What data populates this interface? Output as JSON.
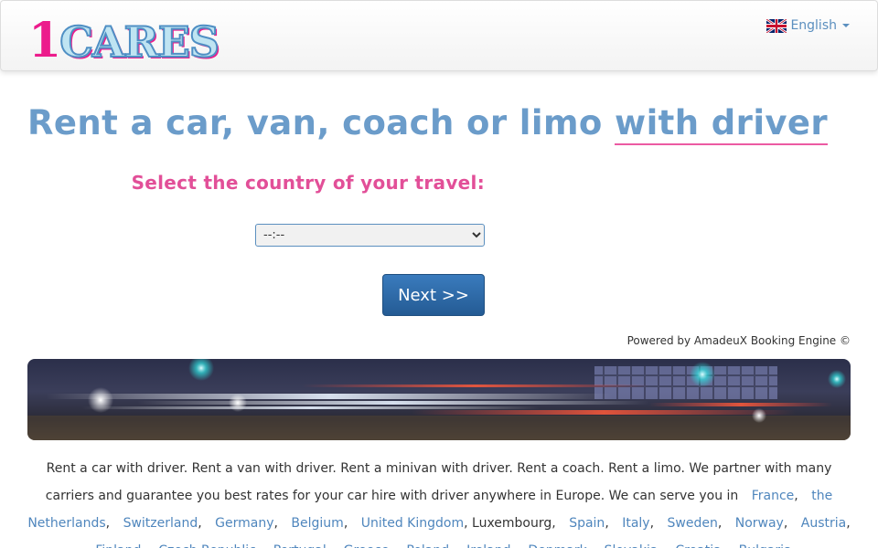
{
  "header": {
    "logo": {
      "number": "1",
      "word": "CARES"
    },
    "language": {
      "label": "English",
      "flag_icon": "uk-flag-icon"
    }
  },
  "main": {
    "headline": {
      "prefix": "Rent a car, van, coach or limo",
      "emphasis": "with driver"
    },
    "select_label": "Select the country of your travel:",
    "country_select": {
      "selected": "--:--"
    },
    "next_button": "Next >>",
    "powered_by": "Powered by AmadeuX Booking Engine ©"
  },
  "description": {
    "intro": "Rent a car with driver. Rent a van with driver. Rent a minivan with driver. Rent a coach. Rent a limo. We partner with many carriers and guarantee you best rates for your car hire with driver anywhere in Europe. We can serve you in",
    "countries": [
      {
        "name": "France",
        "link": true
      },
      {
        "name": "the Netherlands",
        "link": true
      },
      {
        "name": "Switzerland",
        "link": true
      },
      {
        "name": "Germany",
        "link": true
      },
      {
        "name": "Belgium",
        "link": true
      },
      {
        "name": "United Kingdom",
        "link": true
      },
      {
        "name": "Luxembourg",
        "link": false
      },
      {
        "name": "Spain",
        "link": true
      },
      {
        "name": "Italy",
        "link": true
      },
      {
        "name": "Sweden",
        "link": true
      },
      {
        "name": "Norway",
        "link": true
      },
      {
        "name": "Austria",
        "link": true
      },
      {
        "name": "Finland",
        "link": true
      },
      {
        "name": "Czech Republic",
        "link": true
      },
      {
        "name": "Portugal",
        "link": true
      },
      {
        "name": "Greece",
        "link": true
      },
      {
        "name": "Poland",
        "link": true
      },
      {
        "name": "Ireland",
        "link": true
      },
      {
        "name": "Denmark",
        "link": true
      },
      {
        "name": "Slovakia",
        "link": true
      },
      {
        "name": "Croatia",
        "link": true
      },
      {
        "name": "Bulgaria",
        "link": true
      }
    ]
  },
  "colors": {
    "brand_pink": "#ec1c8c",
    "headline_blue": "#6b9cca",
    "label_pink": "#e24f98",
    "link_blue": "#4f86bd",
    "button_blue": "#2f6aa8"
  }
}
